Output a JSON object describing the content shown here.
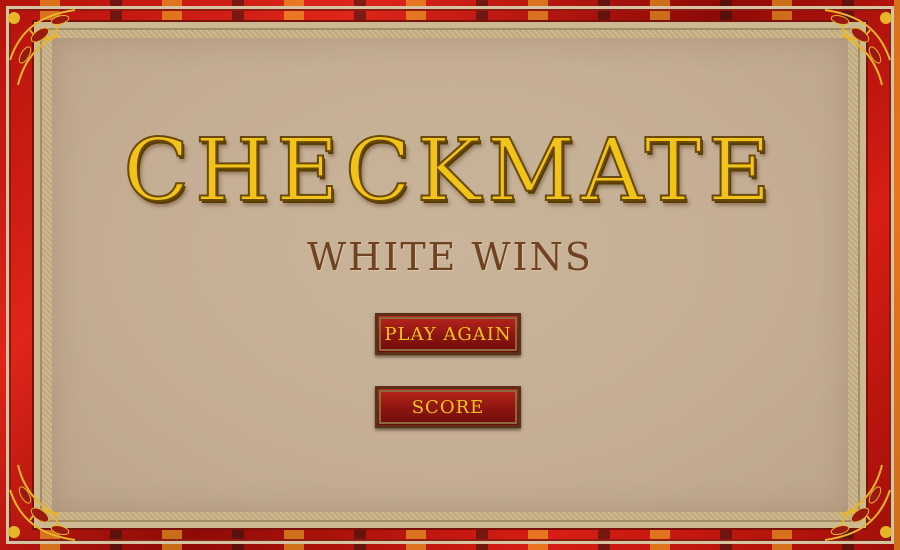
{
  "screen": {
    "title": "CHECKMATE",
    "subtitle": "WHITE WINS"
  },
  "buttons": {
    "play_again_label": "PLAY AGAIN",
    "score_label": "SCORE"
  },
  "colors": {
    "frame_red": "#c41a12",
    "panel_tan": "#c4ad93",
    "title_gold": "#f2c318",
    "subtitle_brown": "#6f4222",
    "button_red": "#8c1510"
  },
  "icons": {
    "corner": "floral-ornament-icon"
  }
}
